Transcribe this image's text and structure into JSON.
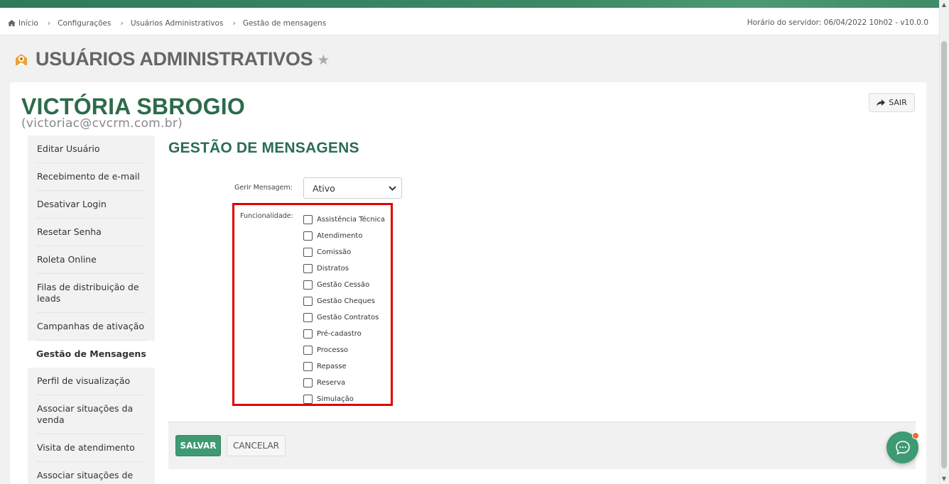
{
  "breadcrumb": {
    "items": [
      "Início",
      "Configurações",
      "Usuários Administrativos",
      "Gestão de mensagens"
    ]
  },
  "server_time": "Horário do servidor: 06/04/2022 10h02 - v10.0.0",
  "page": {
    "title": "USUÁRIOS ADMINISTRATIVOS"
  },
  "user": {
    "name": "VICTÓRIA SBROGIO",
    "email": "(victoriac@cvcrm.com.br)"
  },
  "sair_label": "SAIR",
  "sidebar": {
    "items": [
      {
        "label": "Editar Usuário"
      },
      {
        "label": "Recebimento de e-mail"
      },
      {
        "label": "Desativar Login"
      },
      {
        "label": "Resetar Senha"
      },
      {
        "label": "Roleta Online"
      },
      {
        "label": "Filas de distribuição de leads"
      },
      {
        "label": "Campanhas de ativação"
      },
      {
        "label": "Gestão de Mensagens",
        "active": true
      },
      {
        "label": "Perfil de visualização"
      },
      {
        "label": "Associar situações da venda"
      },
      {
        "label": "Visita de atendimento"
      },
      {
        "label": "Associar situações de"
      }
    ]
  },
  "section_title": "GESTÃO DE MENSAGENS",
  "form": {
    "gerir_label": "Gerir Mensagem:",
    "gerir_value": "Ativo",
    "func_label": "Funcionalidade:",
    "functionalities": [
      "Assistência Técnica",
      "Atendimento",
      "Comissão",
      "Distratos",
      "Gestão Cessão",
      "Gestão Cheques",
      "Gestão Contratos",
      "Pré-cadastro",
      "Processo",
      "Repasse",
      "Reserva",
      "Simulação"
    ]
  },
  "buttons": {
    "save": "SALVAR",
    "cancel": "CANCELAR"
  },
  "colors": {
    "brand_green": "#2c6b4a",
    "button_green": "#3e9a72",
    "highlight_red": "#e00000",
    "notification_orange": "#f26a2e"
  }
}
